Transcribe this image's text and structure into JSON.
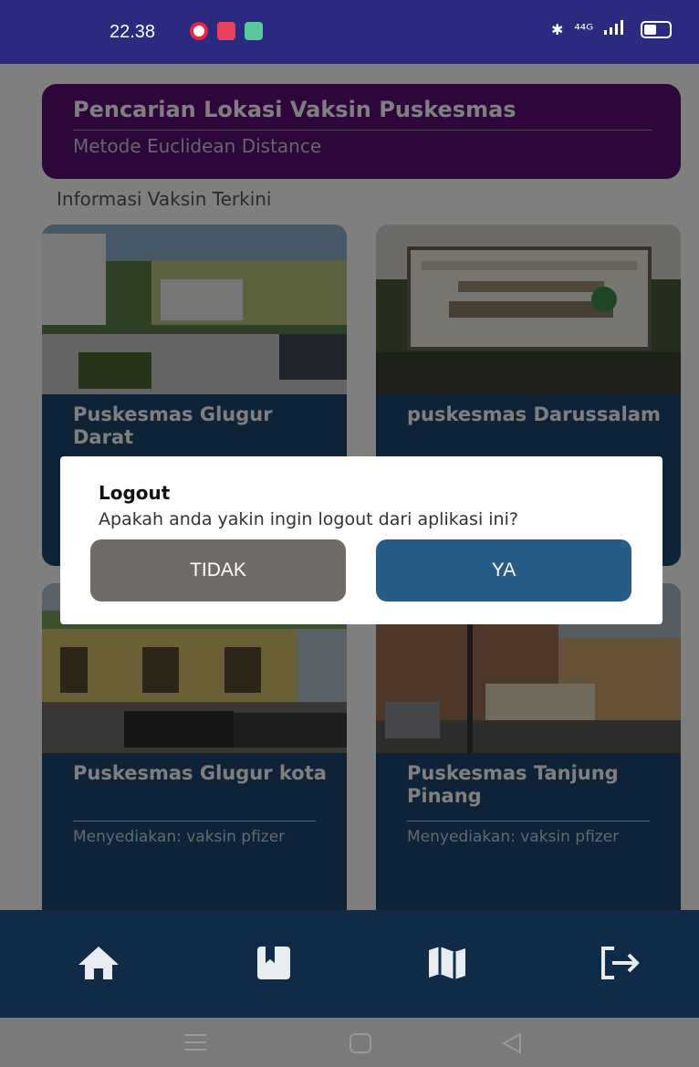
{
  "status_bar": {
    "time": "22.38",
    "network": "⁴⁴ᴳ"
  },
  "header": {
    "title": "Pencarian Lokasi Vaksin Puskesmas",
    "subtitle": "Metode Euclidean Distance"
  },
  "section_title": "Informasi Vaksin Terkini",
  "cards": [
    {
      "name": "Puskesmas Glugur Darat",
      "description": ""
    },
    {
      "name": "puskesmas Darussalam",
      "description": ""
    },
    {
      "name": "Puskesmas Glugur kota",
      "description": "Menyediakan: vaksin pfizer"
    },
    {
      "name": "Puskesmas Tanjung Pinang",
      "description": "Menyediakan: vaksin pfizer"
    }
  ],
  "dialog": {
    "title": "Logout",
    "message": "Apakah anda yakin ingin logout dari aplikasi ini?",
    "cancel_label": "TIDAK",
    "confirm_label": "YA"
  },
  "nav_icons": [
    "home-icon",
    "bookmark-icon",
    "map-icon",
    "logout-icon"
  ],
  "colors": {
    "header": "#5a0f72",
    "card": "#1c466e",
    "navbar": "#0f2b48",
    "confirm": "#275c87",
    "cancel": "#6f6b67",
    "status_bar": "#2a2a80"
  }
}
